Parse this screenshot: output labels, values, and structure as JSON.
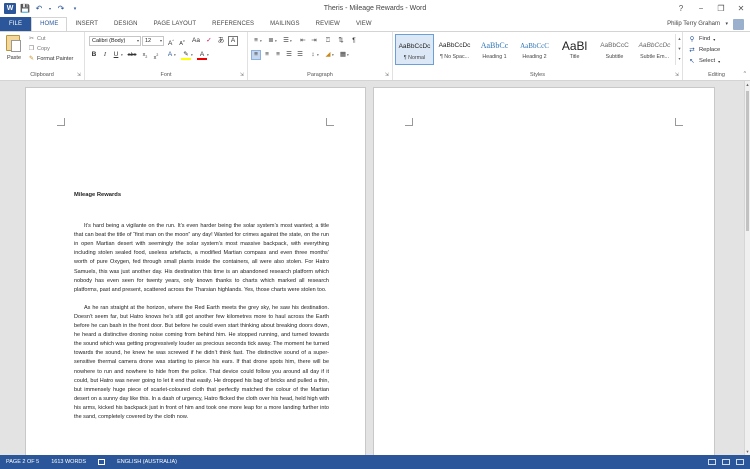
{
  "window": {
    "title": "Theris - Mileage Rewards - Word",
    "logo": "W",
    "controls": [
      "?",
      "−",
      "❐",
      "✕"
    ]
  },
  "tabs": {
    "file": "FILE",
    "items": [
      "HOME",
      "INSERT",
      "DESIGN",
      "PAGE LAYOUT",
      "REFERENCES",
      "MAILINGS",
      "REVIEW",
      "VIEW"
    ],
    "active": "HOME",
    "user": "Philip Terry Graham"
  },
  "ribbon": {
    "clipboard": {
      "label": "Clipboard",
      "paste": "Paste",
      "cut": "Cut",
      "copy": "Copy",
      "format_painter": "Format Painter"
    },
    "font": {
      "label": "Font",
      "font_name": "Calibri (Body)",
      "font_size": "12"
    },
    "paragraph": {
      "label": "Paragraph"
    },
    "styles": {
      "label": "Styles",
      "items": [
        {
          "preview": "AaBbCcDc",
          "name": "¶ Normal"
        },
        {
          "preview": "AaBbCcDc",
          "name": "¶ No Spac..."
        },
        {
          "preview": "AaBbCc",
          "name": "Heading 1"
        },
        {
          "preview": "AaBbCcC",
          "name": "Heading 2"
        },
        {
          "preview": "AaBl",
          "name": "Title"
        },
        {
          "preview": "AaBbCcC",
          "name": "Subtitle"
        },
        {
          "preview": "AaBbCcDc",
          "name": "Subtle Em..."
        }
      ],
      "selected_index": 0
    },
    "editing": {
      "label": "Editing",
      "find": "Find",
      "replace": "Replace",
      "select": "Select"
    }
  },
  "document": {
    "heading": "Mileage Rewards",
    "paragraphs": [
      "It’s hard being a vigilante on the run. It’s even harder being the solar system’s most wanted; a title that can beat the title of “first man on the moon” any day! Wanted for crimes against the state, on the run in open Martian desert with seemingly the solar system’s most massive backpack, with everything including stolen sealed food, useless artefacts, a modified Martian compass and even three months’ worth of pure Oxygen, fed through small plants inside the containers, all were also stolen. For Hatro Samuels, this was just another day. His destination this time is an abandoned research platform which nobody has even seen for twenty years, only known thanks to charts which marked all research platforms, past and present, scattered across the Tharsian highlands. Yes, those charts were stolen too.",
      "As he ran straight at the horizon, where the Red Earth meets the grey sky, he saw his destination. Doesn’t seem far, but Hatro knows he’s still got another few kilometres more to haul across the Earth before he can bash in the front door. But before he could even start thinking about breaking doors down, he heard a distinctive droning noise coming from behind him. He stopped running, and turned towards the sound which was getting progressively louder as precious seconds tick away. The moment he turned towards the sound, he knew he was screwed if he didn’t think fast. The distinctive sound of a super-sensitive thermal camera drone was starting to pierce his ears. If that drone spots him, there will be nowhere to run and nowhere to hide from the police. That device could follow you around all day if it could, but Hatro was never going to let it end that easily. He dropped his bag of bricks and pulled a thin, but immensely huge piece of scarlet-coloured cloth that perfectly matched the colour of the Martian desert on a sunny day like this. In a dash of urgency, Hatro flicked the cloth over his head, held high with his arms, kicked his backpack just in front of him and took one more leap for a more landing further into the sand, completely covered by the cloth now."
    ]
  },
  "status": {
    "page": "PAGE 2 OF 5",
    "words": "1613 WORDS",
    "language": "ENGLISH (AUSTRALIA)"
  }
}
